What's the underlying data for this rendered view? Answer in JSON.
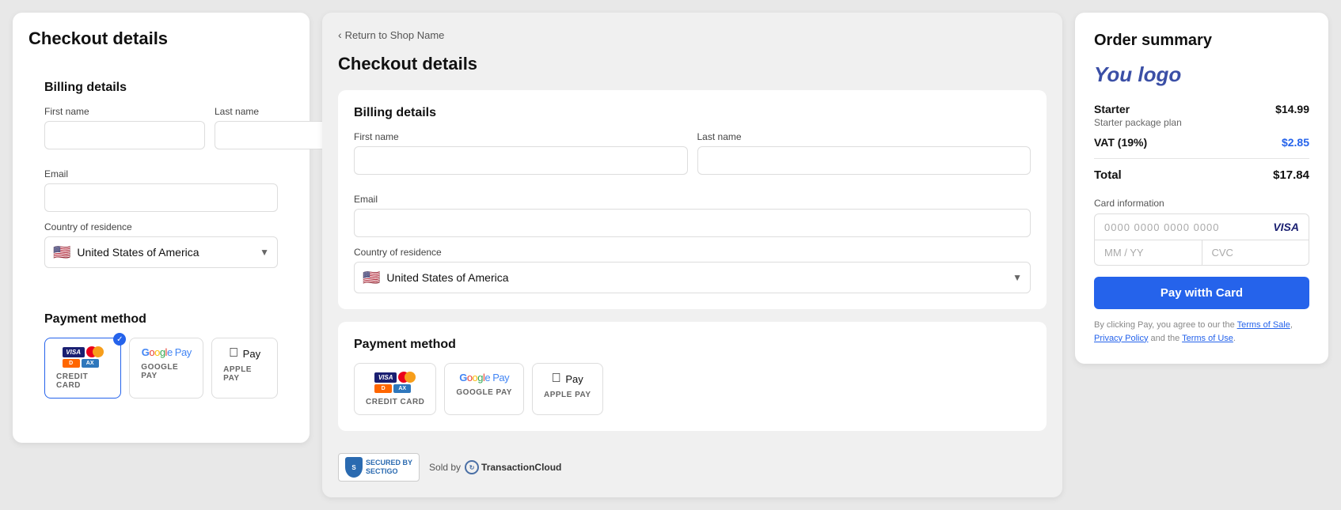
{
  "left_panel": {
    "title": "Checkout details",
    "billing": {
      "section_title": "Billing details",
      "first_name_label": "First name",
      "last_name_label": "Last name",
      "email_label": "Email",
      "country_label": "Country of residence",
      "country_value": "United States of America",
      "country_flag": "🇺🇸"
    },
    "payment": {
      "section_title": "Payment method",
      "options": [
        {
          "id": "credit_card",
          "label": "CREDIT CARD",
          "selected": true
        },
        {
          "id": "google_pay",
          "label": "GOOGLE PAY",
          "selected": false
        },
        {
          "id": "apple_pay",
          "label": "APPLE PAY",
          "selected": false
        }
      ]
    }
  },
  "middle_panel": {
    "back_label": "Return to Shop Name",
    "title": "Checkout details",
    "billing": {
      "section_title": "Billing details",
      "first_name_label": "First name",
      "last_name_label": "Last name",
      "email_label": "Email",
      "country_label": "Country of residence",
      "country_value": "United States of America",
      "country_flag": "🇺🇸"
    },
    "payment": {
      "section_title": "Payment method",
      "options": [
        {
          "id": "credit_card",
          "label": "CREDIT CARD",
          "selected": false
        },
        {
          "id": "google_pay",
          "label": "GOOGLE PAY",
          "selected": false
        },
        {
          "id": "apple_pay",
          "label": "APPLE PAY",
          "selected": false
        }
      ]
    },
    "footer": {
      "secured_by": "SECURED BY",
      "sectigo": "SECTIGO",
      "sold_by": "Sold by",
      "transaction_cloud": "TransactionCloud"
    }
  },
  "right_panel": {
    "title": "Order summary",
    "logo": "You logo",
    "product": {
      "name": "Starter",
      "description": "Starter package plan",
      "price": "$14.99"
    },
    "vat": {
      "label": "VAT (19%)",
      "amount": "$2.85"
    },
    "total": {
      "label": "Total",
      "amount": "$17.84"
    },
    "card_info_label": "Card information",
    "card_placeholder": "0000 0000 0000 0000",
    "visa_label": "VISA",
    "expiry_placeholder": "MM / YY",
    "cvc_placeholder": "CVC",
    "pay_button": "Pay witth Card",
    "terms": {
      "prefix": "By clicking Pay, you agree to our the",
      "terms_of_sale": "Terms of Sale",
      "comma": ",",
      "the": "the",
      "privacy_policy": "Privacy Policy",
      "and": "and the",
      "terms_of_use": "Terms of Use",
      "suffix": "."
    }
  }
}
